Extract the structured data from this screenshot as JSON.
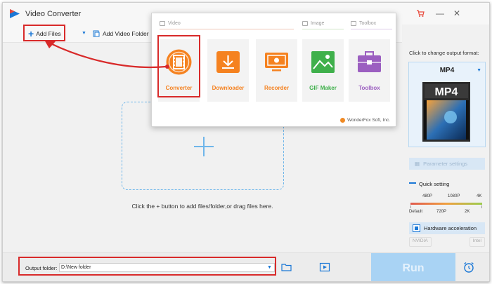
{
  "window": {
    "title": "Video Converter",
    "controls": [
      "—",
      "✕"
    ],
    "cart_icon": "cart-icon"
  },
  "toolbar": {
    "add_files": "Add Files",
    "add_video_folder": "Add Video Folder"
  },
  "main": {
    "hint": "Click the + button to add files/folder,or drag files here."
  },
  "popup": {
    "categories": {
      "video": "Video",
      "image": "Image",
      "toolbox": "Toolbox"
    },
    "tiles": [
      {
        "label": "Converter",
        "color": "#f58220"
      },
      {
        "label": "Downloader",
        "color": "#f58220"
      },
      {
        "label": "Recorder",
        "color": "#f58220"
      },
      {
        "label": "GIF Maker",
        "color": "#3fb04b"
      },
      {
        "label": "Toolbox",
        "color": "#9b5fc0"
      }
    ],
    "footer": "WonderFox Soft, Inc."
  },
  "right_panel": {
    "change_format_label": "Click to change output format:",
    "format": "MP4",
    "format_art_text": "MP4",
    "parameter_settings": "Parameter settings",
    "quick_setting": "Quick setting",
    "quality_top": [
      "480P",
      "1080P",
      "4K"
    ],
    "quality_bottom": [
      "Default",
      "720P",
      "2K"
    ],
    "hardware_acceleration": "Hardware acceleration",
    "gpu": [
      "NVIDIA",
      "Intel"
    ]
  },
  "bottom": {
    "output_folder_label": "Output folder:",
    "output_folder_value": "D:\\New folder",
    "run": "Run"
  },
  "colors": {
    "accent": "#1b78d6",
    "highlight": "#d82a2a",
    "run_bg": "#a9d3f4"
  }
}
